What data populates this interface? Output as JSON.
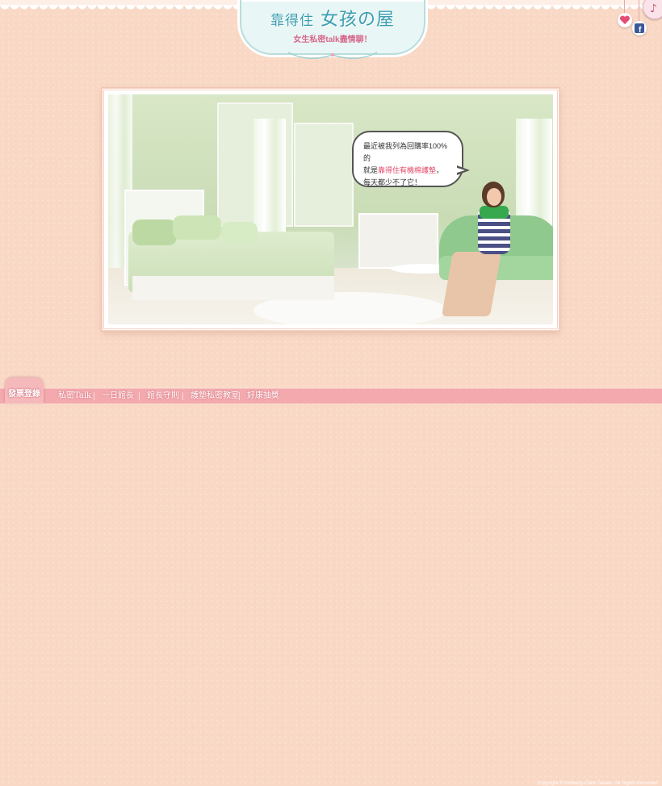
{
  "logo": {
    "title_left": "靠得住",
    "title_right": "女孩の屋",
    "subtitle": "女生私密talk盡情聊！"
  },
  "top_icons": {
    "heart": "heart-icon",
    "facebook": "facebook-icon",
    "music": "music-note-icon"
  },
  "scene": {
    "bubble_line1": "最近被我列為回購率100%的",
    "bubble_line2_prefix": "就是",
    "bubble_line2_highlight": "靠得住有機棉護墊",
    "bubble_line2_suffix": "，",
    "bubble_line3": "每天都少不了它！"
  },
  "nav": {
    "active_tab": "發票登錄",
    "items": [
      "私密Talk",
      "一日館長",
      "館長守則",
      "護墊私密教室",
      "好康抽獎"
    ]
  },
  "footer": {
    "copyright": "Copyright © Kimberly-Clark Taiwan. All Rights Reserved."
  },
  "colors": {
    "background": "#f9d9c6",
    "navbar": "#f3a9ad",
    "logo_title": "#3a9db0",
    "logo_sub": "#d6688a",
    "highlight": "#e24b6b"
  }
}
